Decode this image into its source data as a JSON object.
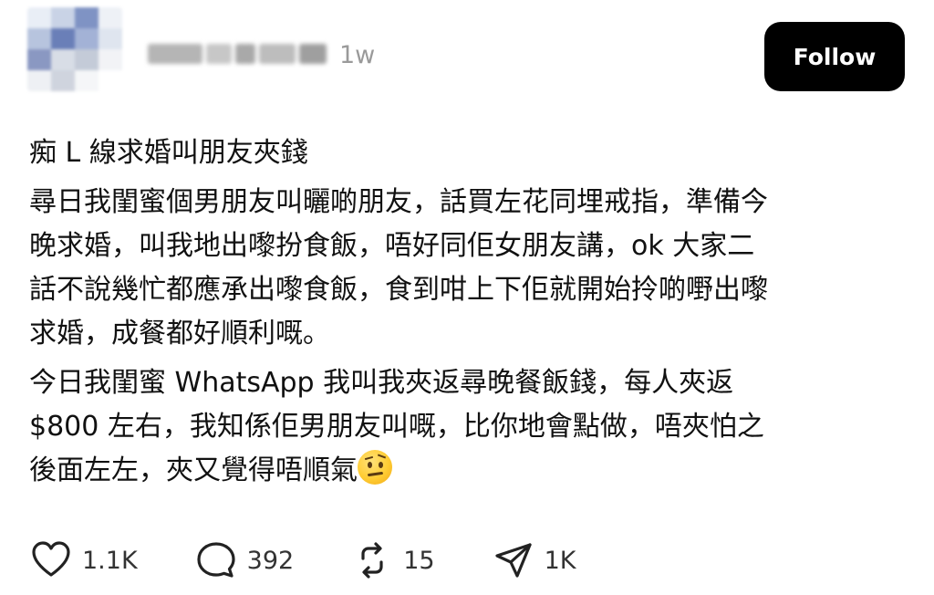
{
  "header": {
    "timestamp": "1w",
    "follow_label": "Follow"
  },
  "post": {
    "title": "痴 L 線求婚叫朋友夾錢",
    "paragraph_1": "尋日我閨蜜個男朋友叫曬啲朋友，話買左花同埋戒指，準備今\n晚求婚，叫我地出嚟扮食飯，唔好同佢女朋友講，ok 大家二\n話不說幾忙都應承出嚟食飯，食到咁上下佢就開始拎啲嘢出嚟\n求婚，成餐都好順利嘅。",
    "paragraph_2": "今日我閨蜜 WhatsApp 我叫我夾返尋晚餐飯錢，每人夾返\n$800 左右，我知係佢男朋友叫嘅，比你地會點做，唔夾怕之\n後面左左，夾又覺得唔順氣",
    "emoji": "face-with-raised-eyebrow"
  },
  "actions": {
    "likes": "1.1K",
    "comments": "392",
    "reposts": "15",
    "shares": "1K"
  }
}
